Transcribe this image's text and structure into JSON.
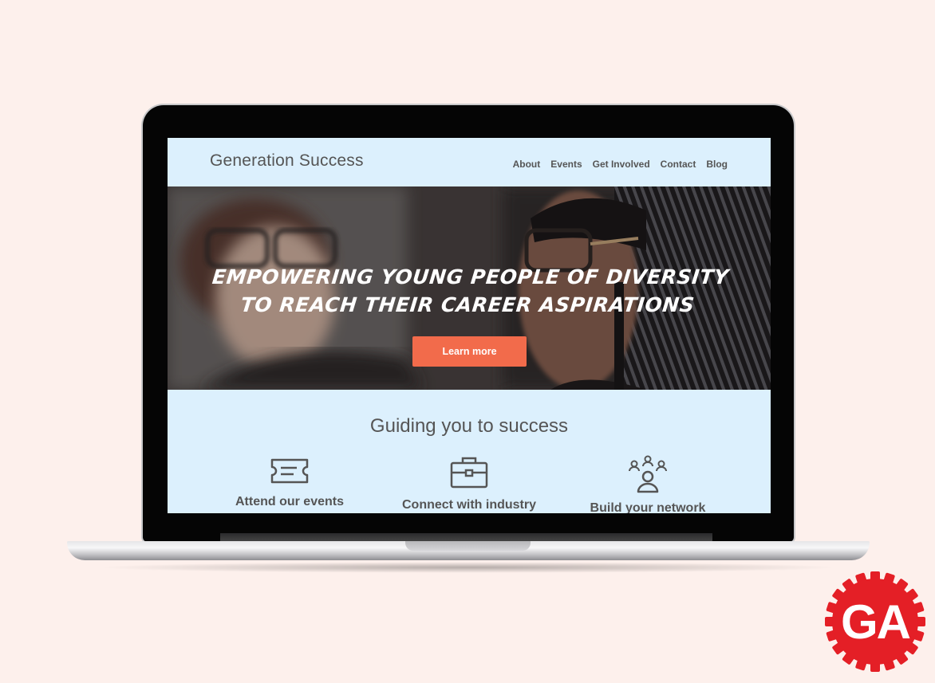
{
  "site": {
    "title": "Generation Success",
    "nav": [
      "About",
      "Events",
      "Get Involved",
      "Contact",
      "Blog"
    ]
  },
  "hero": {
    "heading_line1": "EMPOWERING YOUNG PEOPLE OF DIVERSITY",
    "heading_line2": "TO REACH THEIR CAREER ASPIRATIONS",
    "button_label": "Learn more"
  },
  "section": {
    "title": "Guiding you to success",
    "features": [
      {
        "icon": "ticket-icon",
        "label": "Attend our events"
      },
      {
        "icon": "briefcase-icon",
        "label": "Connect with industry"
      },
      {
        "icon": "people-network-icon",
        "label": "Build your network"
      }
    ]
  },
  "logo": {
    "text": "GA"
  },
  "colors": {
    "page_background": "#fdf0ec",
    "site_background": "#dcf0fd",
    "accent": "#f26b4b",
    "text": "#555555",
    "logo_red": "#e41f26"
  }
}
